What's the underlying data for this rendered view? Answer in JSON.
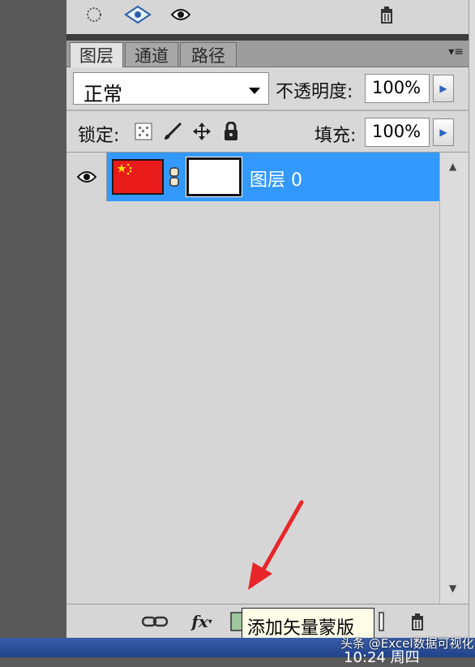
{
  "top_toolbar": {
    "icons": [
      "selection-circle-icon",
      "mask-icon",
      "eye-icon",
      "trash-icon"
    ]
  },
  "tabs": [
    {
      "label": "图层",
      "active": true
    },
    {
      "label": "通道",
      "active": false
    },
    {
      "label": "路径",
      "active": false
    }
  ],
  "blend": {
    "mode": "正常"
  },
  "opacity": {
    "label": "不透明度:",
    "value": "100%"
  },
  "lock": {
    "label": "锁定:"
  },
  "fill": {
    "label": "填充:",
    "value": "100%"
  },
  "layers": [
    {
      "name": "图层 0",
      "visible": true,
      "selected": true
    }
  ],
  "bottom_bar": {
    "icons": [
      "link-icon",
      "fx-icon",
      "add-mask-icon",
      "adjustment-icon",
      "group-icon",
      "new-layer-icon",
      "trash-icon"
    ]
  },
  "tooltip": {
    "text": "添加矢量蒙版"
  },
  "watermark": {
    "text": "头条 @Excel数据可视化"
  },
  "taskbar": {
    "clock": "10:24 周四"
  },
  "colors": {
    "selected_row": "#3399ff",
    "annotation": "#e8262a",
    "flag": "#e81a1a"
  }
}
